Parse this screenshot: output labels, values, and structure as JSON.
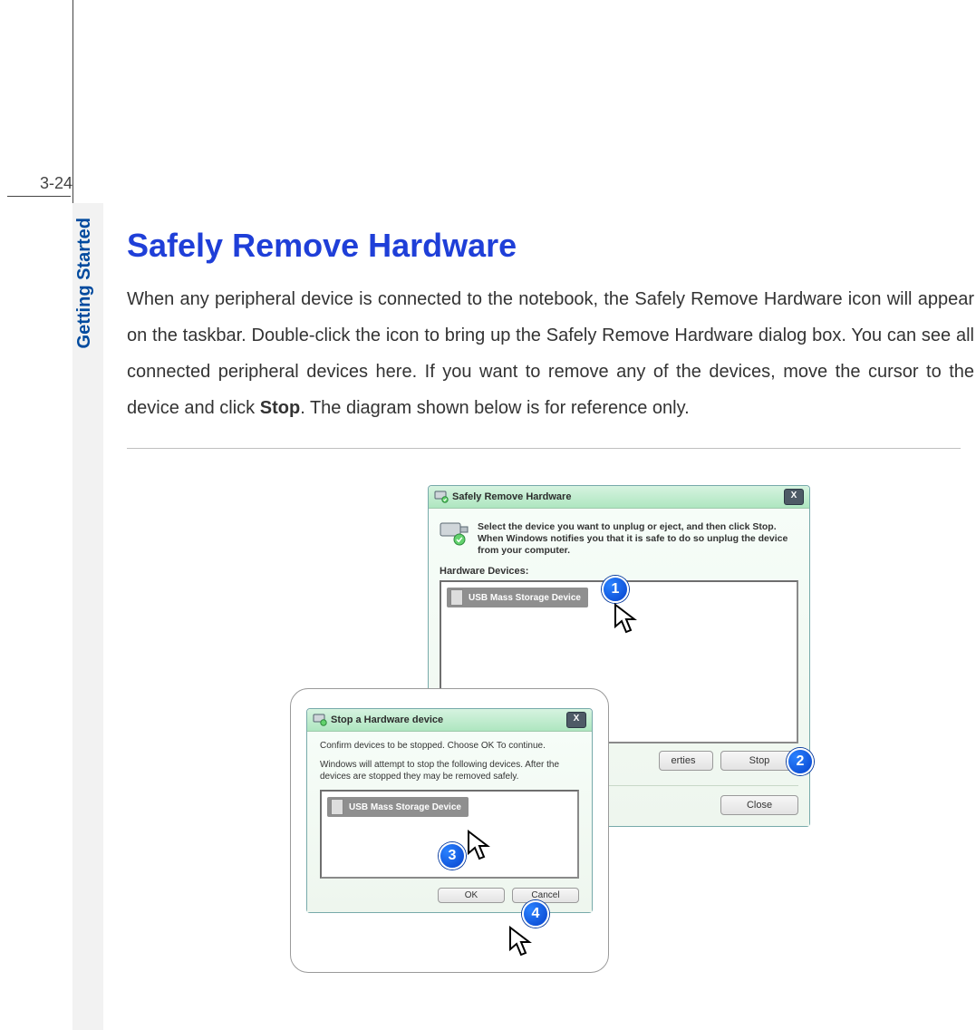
{
  "page": {
    "number": "3-24",
    "tab_label": "Getting Started",
    "heading": "Safely Remove Hardware",
    "paragraph_parts": {
      "p1": "When any peripheral device is connected to the notebook, the Safely Remove Hardware icon will appear on the taskbar.  Double-click the icon to bring up the Safely Remove Hardware dialog box. You can see all connected peripheral devices here.  If you want to remove any of the devices, move the cursor to the device and click ",
      "bold": "Stop",
      "p2": ".  The diagram shown below is for reference only."
    }
  },
  "dialog1": {
    "title": "Safely Remove Hardware",
    "instruction": "Select the device you want to unplug or eject, and then click Stop. When Windows notifies you that it is safe to do so unplug the device from your computer.",
    "devices_label": "Hardware Devices:",
    "device_item": "USB Mass Storage Device",
    "properties_btn": "Properties",
    "properties_btn_visible": "erties",
    "stop_btn": "Stop",
    "close_btn": "Close"
  },
  "dialog2": {
    "title": "Stop a Hardware device",
    "line1": "Confirm devices to be stopped.  Choose OK To continue.",
    "line2": "Windows will attempt to stop the following devices. After the devices are stopped they may be removed safely.",
    "device_item": "USB Mass Storage Device",
    "ok_btn": "OK",
    "cancel_btn": "Cancel"
  },
  "callouts": {
    "c1": "1",
    "c2": "2",
    "c3": "3",
    "c4": "4"
  }
}
